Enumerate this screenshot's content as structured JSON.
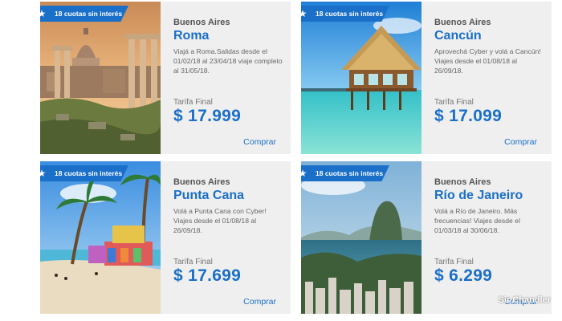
{
  "badge_icon": "star-icon",
  "colors": {
    "accent": "#1a6fc9",
    "card_bg": "#efefef"
  },
  "offers": [
    {
      "badge": "18 cuotas sin interés",
      "origin": "Buenos Aires",
      "destination": "Roma",
      "description": "Viajá a Roma.Salidas desde el 01/02/18 al 23/04/18 viaje completo al 31/05/18.",
      "fare_label": "Tarifa Final",
      "price": "$ 17.999",
      "buy_label": "Comprar"
    },
    {
      "badge": "18 cuotas sin interés",
      "origin": "Buenos Aires",
      "destination": "Cancún",
      "description": "Aprovechá Cyber y volá a Cancún! Viajes desde el 01/08/18 al 26/09/18.",
      "fare_label": "Tarifa Final",
      "price": "$ 17.099",
      "buy_label": "Comprar"
    },
    {
      "badge": "18 cuotas sin interés",
      "origin": "Buenos Aires",
      "destination": "Punta Cana",
      "description": "Volá a Punta Cana con Cyber! Viajes desde el 01/08/18 al 26/09/18.",
      "fare_label": "Tarifa Final",
      "price": "$ 17.699",
      "buy_label": "Comprar"
    },
    {
      "badge": "18 cuotas sin interés",
      "origin": "Buenos Aires",
      "destination": "Río de Janeiro",
      "description": "Volá a Río de Janeiro. Más frecuencias! Viajes desde el 01/03/18 al 30/06/18.",
      "fare_label": "Tarifa Final",
      "price": "$ 6.299",
      "buy_label": "Comprar"
    }
  ],
  "watermark": "Sir Chandler"
}
